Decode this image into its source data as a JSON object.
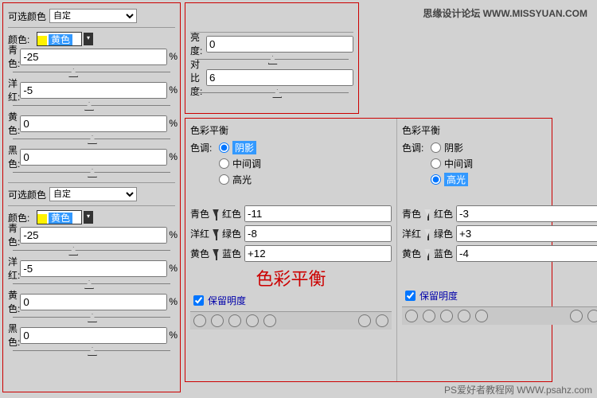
{
  "header_watermark": "思缘设计论坛  WWW.MISSYUAN.COM",
  "footer_watermark": "PS爱好者教程网 WWW.psahz.com",
  "selective": {
    "title": "可选颜色",
    "preset_label": "可选颜色",
    "preset_value": "自定",
    "color_label": "颜色:",
    "color_value": "黄色",
    "cyan": {
      "label": "青色:",
      "val": "-25"
    },
    "magenta": {
      "label": "洋红:",
      "val": "-5"
    },
    "yellow": {
      "label": "黄色:",
      "val": "0"
    },
    "black": {
      "label": "黑色:",
      "val": "0"
    },
    "percent": "%"
  },
  "brightness": {
    "b_label": "亮度:",
    "b_val": "0",
    "c_label": "对比度:",
    "c_val": "6"
  },
  "color_balance": {
    "title": "色彩平衡",
    "tone_label": "色调:",
    "tone_shadow": "阴影",
    "tone_mid": "中间调",
    "tone_hi": "高光",
    "cyan": "青色",
    "red": "红色",
    "magenta": "洋红",
    "green": "绿色",
    "yellow": "黄色",
    "blue": "蓝色",
    "preserve": "保留明度",
    "left": {
      "v1": "-11",
      "v2": "-8",
      "v3": "+12"
    },
    "right": {
      "v1": "-3",
      "v2": "+3",
      "v3": "-4"
    },
    "caption": "色彩平衡"
  }
}
